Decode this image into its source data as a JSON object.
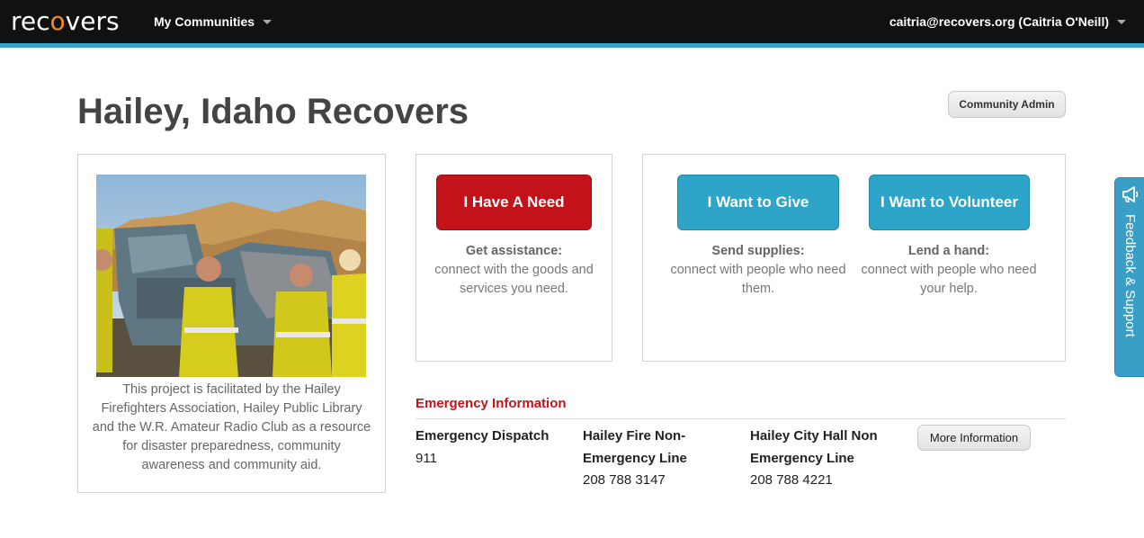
{
  "nav": {
    "logo_pre": "rec",
    "logo_o": "o",
    "logo_post": "vers",
    "communities_label": "My Communities",
    "user_label": "caitria@recovers.org (Caitria O'Neill)"
  },
  "page": {
    "title": "Hailey, Idaho Recovers",
    "admin_button": "Community Admin"
  },
  "about": {
    "caption": "This project is facilitated by the Hailey Firefighters Association, Hailey Public Library and the W.R. Amateur Radio Club as a resource for disaster preparedness, community awareness and community aid."
  },
  "actions": {
    "need": {
      "button": "I Have A Need",
      "head": "Get assistance:",
      "text": "connect with the goods and services you need."
    },
    "give": {
      "button": "I Want to Give",
      "head": "Send supplies:",
      "text": "connect with people who need them."
    },
    "volunteer": {
      "button": "I Want to Volunteer",
      "head": "Lend a hand:",
      "text": "connect with people who need your help."
    }
  },
  "emergency": {
    "title": "Emergency Information",
    "contacts": [
      {
        "label": "Emergency Dispatch",
        "number": "911"
      },
      {
        "label": "Hailey Fire Non-Emergency Line",
        "number": "208 788 3147"
      },
      {
        "label": "Hailey City Hall Non Emergency Line",
        "number": "208 788 4221"
      }
    ],
    "more_button": "More Information"
  },
  "feedback": {
    "label": "Feedback & Support"
  },
  "colors": {
    "topbar": "#111111",
    "stripe": "#3aa1c9",
    "accent_red": "#c4121b",
    "accent_blue": "#2ea4c9",
    "logo_orange": "#f08a24"
  }
}
